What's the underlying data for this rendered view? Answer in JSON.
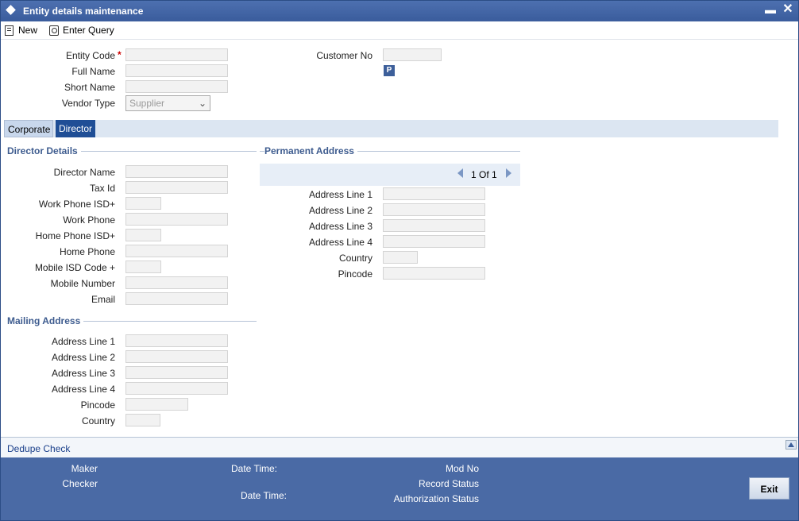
{
  "window": {
    "title": "Entity details maintenance",
    "minimize": "▬",
    "close": "✕"
  },
  "toolbar": {
    "new_label": "New",
    "enter_query_label": "Enter Query"
  },
  "header_form": {
    "entity_code_label": "Entity Code",
    "required_mark": "*",
    "full_name_label": "Full Name",
    "short_name_label": "Short Name",
    "vendor_type_label": "Vendor Type",
    "vendor_type_value": "Supplier",
    "customer_no_label": "Customer No",
    "p_button": "P"
  },
  "tabs": {
    "corporate": "Corporate",
    "director": "Director"
  },
  "director_details": {
    "title": "Director Details",
    "director_name": "Director Name",
    "tax_id": "Tax Id",
    "work_phone_isd": "Work Phone ISD+",
    "work_phone": "Work Phone",
    "home_phone_isd": "Home Phone ISD+",
    "home_phone": "Home Phone",
    "mobile_isd": "Mobile ISD Code +",
    "mobile_number": "Mobile Number",
    "email": "Email"
  },
  "mailing_address": {
    "title": "Mailing Address",
    "line1": "Address Line 1",
    "line2": "Address Line 2",
    "line3": "Address Line 3",
    "line4": "Address Line 4",
    "pincode": "Pincode",
    "country": "Country"
  },
  "permanent_address": {
    "title": "Permanent Address",
    "pager": "1 Of 1",
    "line1": "Address Line 1",
    "line2": "Address Line 2",
    "line3": "Address Line 3",
    "line4": "Address Line 4",
    "country": "Country",
    "pincode": "Pincode"
  },
  "dedupe": {
    "label": "Dedupe Check"
  },
  "footer": {
    "maker": "Maker",
    "checker": "Checker",
    "date_time_1": "Date Time:",
    "date_time_2": "Date Time:",
    "mod_no": "Mod No",
    "record_status": "Record Status",
    "authorization_status": "Authorization Status",
    "exit": "Exit"
  },
  "colors": {
    "title_bar": "#3a5c9c",
    "footer": "#4a6aa5",
    "tab_active": "#1f4e96",
    "section_title": "#3e5c8f"
  }
}
